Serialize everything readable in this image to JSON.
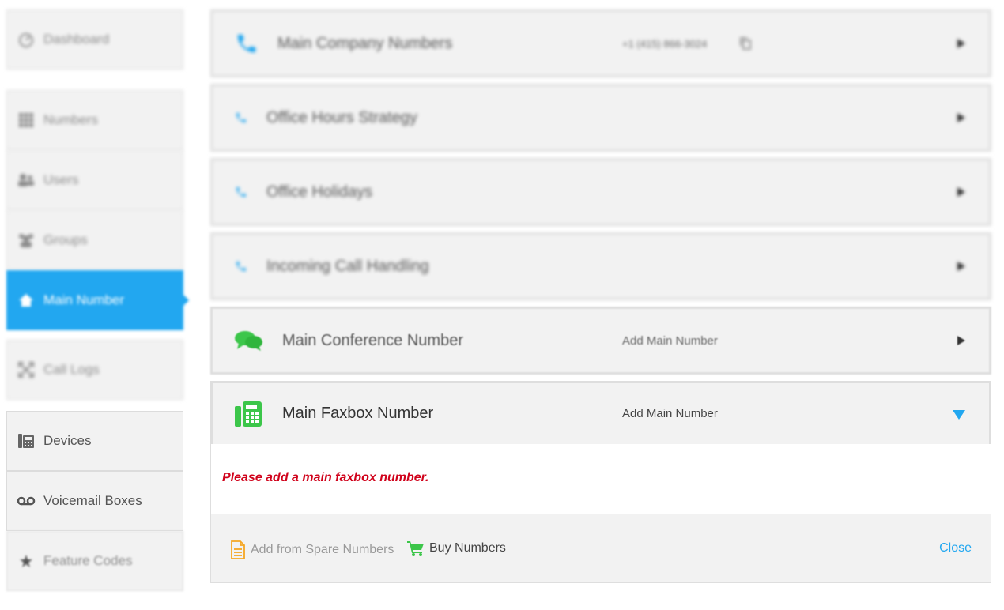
{
  "sidebar": {
    "items": [
      {
        "label": "Dashboard",
        "icon": "dashboard-icon"
      },
      {
        "label": "Numbers",
        "icon": "grid-icon"
      },
      {
        "label": "Users",
        "icon": "users-icon"
      },
      {
        "label": "Groups",
        "icon": "groups-icon"
      },
      {
        "label": "Main Number",
        "icon": "home-icon"
      },
      {
        "label": "Call Logs",
        "icon": "call-logs-icon"
      },
      {
        "label": "Devices",
        "icon": "desk-phone-icon"
      },
      {
        "label": "Voicemail Boxes",
        "icon": "voicemail-icon"
      },
      {
        "label": "Feature Codes",
        "icon": "star-icon"
      }
    ]
  },
  "main": {
    "rows": [
      {
        "title": "Main Company Numbers",
        "value": "+1 (415) 866-3024",
        "icon": "phone-icon"
      },
      {
        "title": "Office Hours Strategy",
        "icon": "phone-icon"
      },
      {
        "title": "Office Holidays",
        "icon": "phone-icon"
      },
      {
        "title": "Incoming Call Handling",
        "icon": "phone-icon"
      },
      {
        "title": "Main Conference Number",
        "value": "Add Main Number",
        "icon": "chat-bubbles-icon"
      },
      {
        "title": "Main Faxbox Number",
        "value": "Add Main Number",
        "icon": "fax-icon"
      }
    ],
    "faxbox_panel": {
      "message": "Please add a main faxbox number.",
      "add_spare": "Add from Spare Numbers",
      "buy_numbers": "Buy Numbers",
      "close": "Close"
    }
  },
  "colors": {
    "accent": "#22a7f0",
    "error": "#d0021b",
    "green": "#3cc64a",
    "orange": "#f5a623"
  }
}
